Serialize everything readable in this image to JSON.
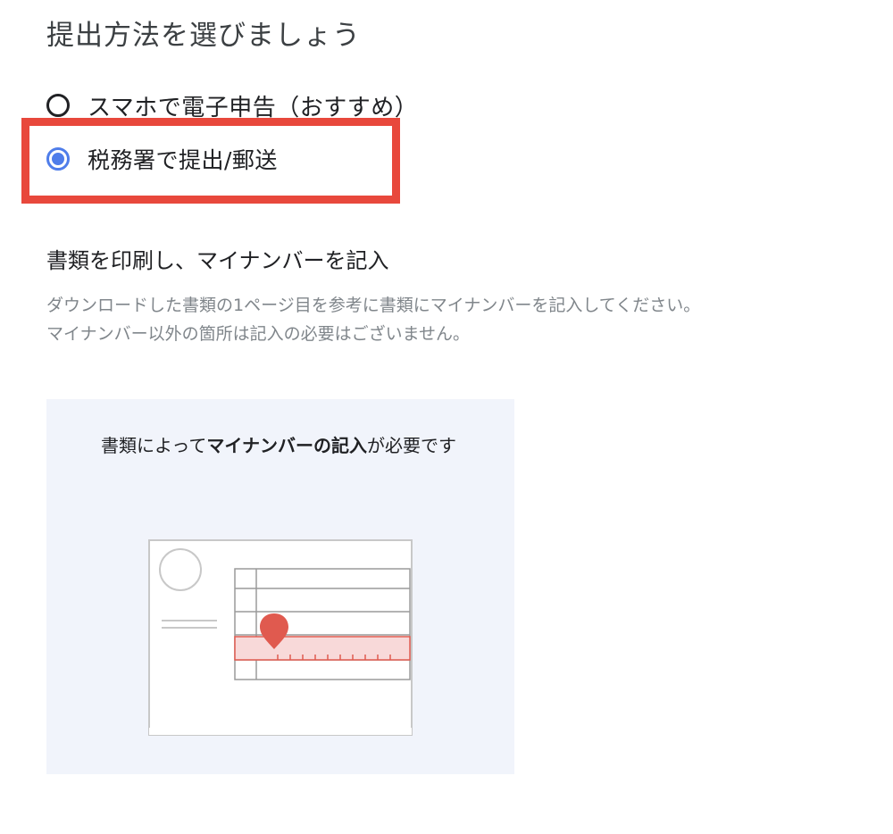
{
  "page": {
    "title": "提出方法を選びましょう"
  },
  "submission_options": [
    {
      "label": "スマホで電子申告（おすすめ）",
      "selected": false
    },
    {
      "label": "税務署で提出/郵送",
      "selected": true
    }
  ],
  "highlight": {
    "color": "#e8483c"
  },
  "section": {
    "heading": "書類を印刷し、マイナンバーを記入",
    "description_lines": [
      "ダウンロードした書類の1ページ目を参考に書類にマイナンバーを記入してください。",
      "マイナンバー以外の箇所は記入の必要はございません。"
    ]
  },
  "info_card": {
    "text_before": "書類によって",
    "text_bold": "マイナンバーの記入",
    "text_after": "が必要です",
    "background_color": "#f1f4fb",
    "illustration_icon": "document-mynumber-icon"
  },
  "colors": {
    "accent_radio": "#4f7dea",
    "marker": "#e05a4f",
    "highlight_row": "#f8d9d9"
  }
}
